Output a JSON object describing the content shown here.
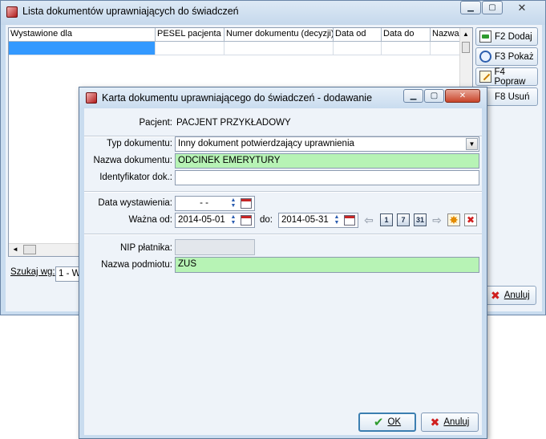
{
  "back_window": {
    "title": "Lista dokumentów uprawniających do świadczeń",
    "columns": [
      "Wystawione dla",
      "PESEL pacjenta",
      "Numer dokumentu (decyzji)",
      "Data od",
      "Data do",
      "Nazwa"
    ],
    "buttons": {
      "add": "F2 Dodaj",
      "view": "F3 Pokaż",
      "edit": "F4 Popraw",
      "delete": "F8 Usuń",
      "cancel": "Anuluj"
    },
    "search_label": "Szukaj wg:",
    "search_value": "1 - W"
  },
  "dialog": {
    "title": "Karta dokumentu uprawniającego do świadczeń - dodawanie",
    "patient_label": "Pacjent:",
    "patient_value": "PACJENT PRZYKŁADOWY",
    "doc_type_label": "Typ dokumentu:",
    "doc_type_value": "Inny dokument potwierdzający uprawnienia",
    "doc_name_label": "Nazwa dokumentu:",
    "doc_name_value": "ODCINEK EMERYTURY",
    "doc_id_label": "Identyfikator dok.:",
    "doc_id_value": "",
    "issue_date_label": "Data wystawienia:",
    "issue_date_value": "-   -",
    "valid_from_label": "Ważna od:",
    "valid_from_value": "2014-05-01",
    "valid_to_label": "do:",
    "valid_to_value": "2014-05-31",
    "nav_labels": [
      "1",
      "7",
      "31"
    ],
    "nip_label": "NIP płatnika:",
    "nip_value": "",
    "entity_label": "Nazwa podmiotu:",
    "entity_value": "ZUS",
    "ok_label": "OK",
    "cancel_label": "Anuluj"
  },
  "colors": {
    "selection": "#3399ff",
    "green_field": "#b7f3b5",
    "window_frame": "#c9dcef"
  }
}
